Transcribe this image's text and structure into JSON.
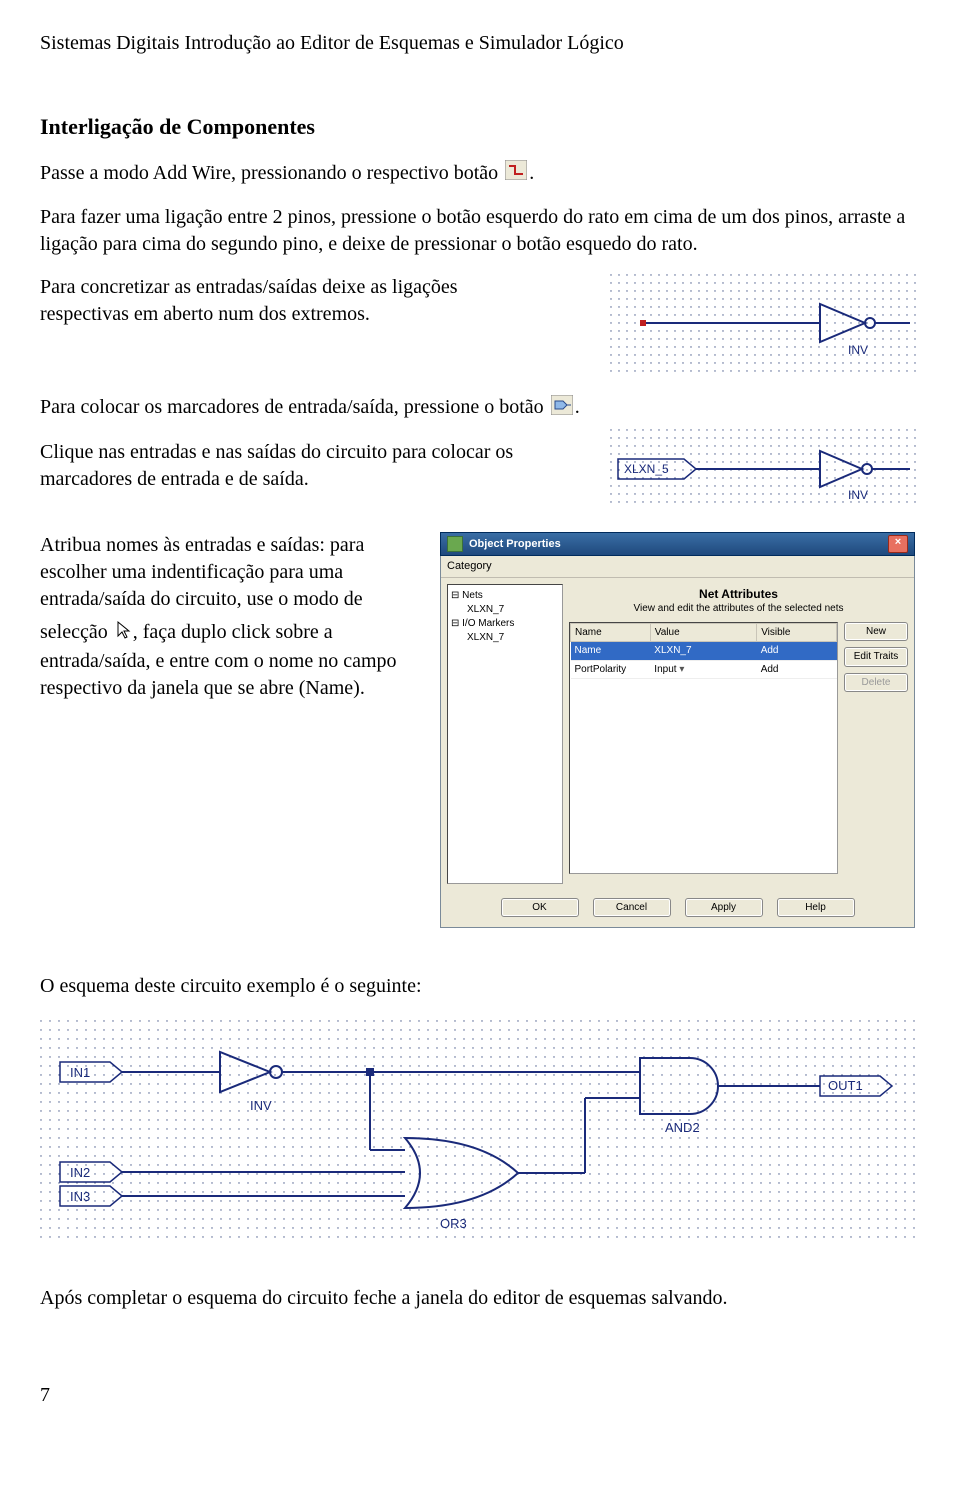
{
  "header": "Sistemas Digitais Introdução ao Editor de Esquemas e Simulador Lógico",
  "section_title": "Interligação de Componentes",
  "para1a": "Passe a modo Add Wire, pressionando o respectivo botão ",
  "para1b": ".",
  "para2": "Para fazer uma ligação entre 2 pinos, pressione o botão esquerdo do rato em cima de um dos pinos, arraste a ligação para cima do segundo pino, e deixe de pressionar o botão esquedo do rato.",
  "para3": "Para concretizar as entradas/saídas deixe as ligações respectivas em aberto num dos extremos.",
  "para4a": "Para colocar os marcadores de entrada/saída, pressione o botão ",
  "para4b": ".",
  "para5": "Clique nas entradas e nas saídas do circuito para colocar os marcadores de entrada e de saída.",
  "para6a": "Atribua nomes às entradas e saídas: para escolher uma indentificação para uma entrada/saída do circuito, use o modo de",
  "para6b": "selecção ",
  "para6c": ", faça duplo click sobre a entrada/saída, e entre com o nome no campo respectivo da janela que se abre (Name).",
  "dlg": {
    "title": "Object Properties",
    "menu": "Category",
    "tree": [
      "⊟ Nets",
      "    XLXN_7",
      "⊟ I/O Markers",
      "    XLXN_7"
    ],
    "pane_title": "Net Attributes",
    "pane_sub": "View and edit the attributes of the selected nets",
    "cols": [
      "Name",
      "Value",
      "Visible"
    ],
    "row1": [
      "Name",
      "XLXN_7",
      "Add"
    ],
    "row2": [
      "PortPolarity",
      "Input",
      "Add"
    ],
    "btn_new": "New",
    "btn_edit": "Edit Traits",
    "btn_del": "Delete",
    "btn_ok": "OK",
    "btn_cancel": "Cancel",
    "btn_apply": "Apply",
    "btn_help": "Help"
  },
  "para7": "O esquema deste circuito exemplo é o seguinte:",
  "para8": "Após completar o esquema do circuito feche a janela do editor de esquemas salvando.",
  "page_num": "7",
  "schematic1": {
    "inv_label": "INV"
  },
  "schematic2": {
    "marker": "XLXN_5",
    "inv_label": "INV"
  },
  "schematic3": {
    "in1": "IN1",
    "in2": "IN2",
    "in3": "IN3",
    "inv": "INV",
    "or3": "OR3",
    "and2": "AND2",
    "out1": "OUT1"
  }
}
